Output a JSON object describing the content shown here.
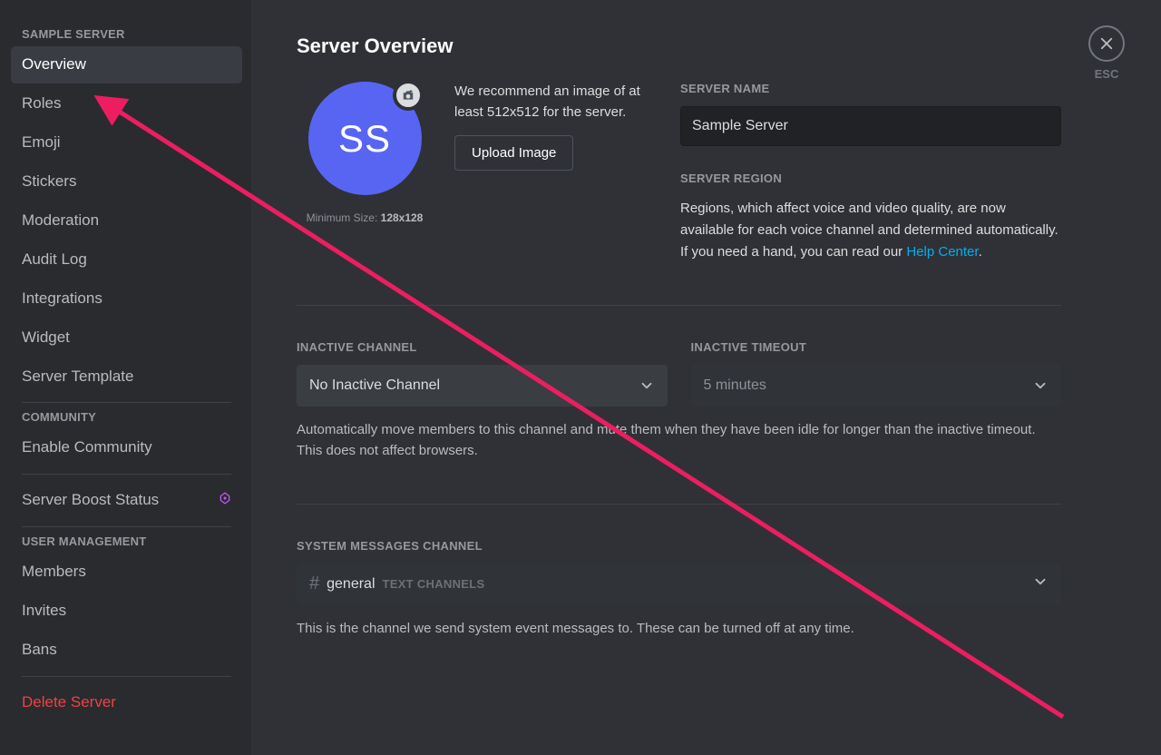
{
  "sidebar": {
    "section1_header": "SAMPLE SERVER",
    "items1": [
      {
        "label": "Overview",
        "selected": true
      },
      {
        "label": "Roles"
      },
      {
        "label": "Emoji"
      },
      {
        "label": "Stickers"
      },
      {
        "label": "Moderation"
      },
      {
        "label": "Audit Log"
      },
      {
        "label": "Integrations"
      },
      {
        "label": "Widget"
      },
      {
        "label": "Server Template"
      }
    ],
    "section2_header": "COMMUNITY",
    "items2": [
      {
        "label": "Enable Community"
      }
    ],
    "boost_label": "Server Boost Status",
    "section3_header": "USER MANAGEMENT",
    "items3": [
      {
        "label": "Members"
      },
      {
        "label": "Invites"
      },
      {
        "label": "Bans"
      }
    ],
    "delete_label": "Delete Server"
  },
  "main": {
    "title": "Server Overview",
    "avatar_initials": "SS",
    "min_size_prefix": "Minimum Size: ",
    "min_size_value": "128x128",
    "upload_hint": "We recommend an image of at least 512x512 for the server.",
    "upload_btn": "Upload Image",
    "server_name_label": "SERVER NAME",
    "server_name_value": "Sample Server",
    "server_region_label": "SERVER REGION",
    "region_desc_1": "Regions, which affect voice and video quality, are now available for each voice channel and determined automatically. If you need a hand, you can read our ",
    "region_link": "Help Center",
    "region_desc_2": ".",
    "inactive_channel_label": "INACTIVE CHANNEL",
    "inactive_channel_value": "No Inactive Channel",
    "inactive_timeout_label": "INACTIVE TIMEOUT",
    "inactive_timeout_value": "5 minutes",
    "inactive_help": "Automatically move members to this channel and mute them when they have been idle for longer than the inactive timeout. This does not affect browsers.",
    "sys_label": "SYSTEM MESSAGES CHANNEL",
    "sys_hash": "#",
    "sys_channel": "general",
    "sys_category": "TEXT CHANNELS",
    "sys_help": "This is the channel we send system event messages to. These can be turned off at any time."
  },
  "close": {
    "esc": "ESC"
  }
}
